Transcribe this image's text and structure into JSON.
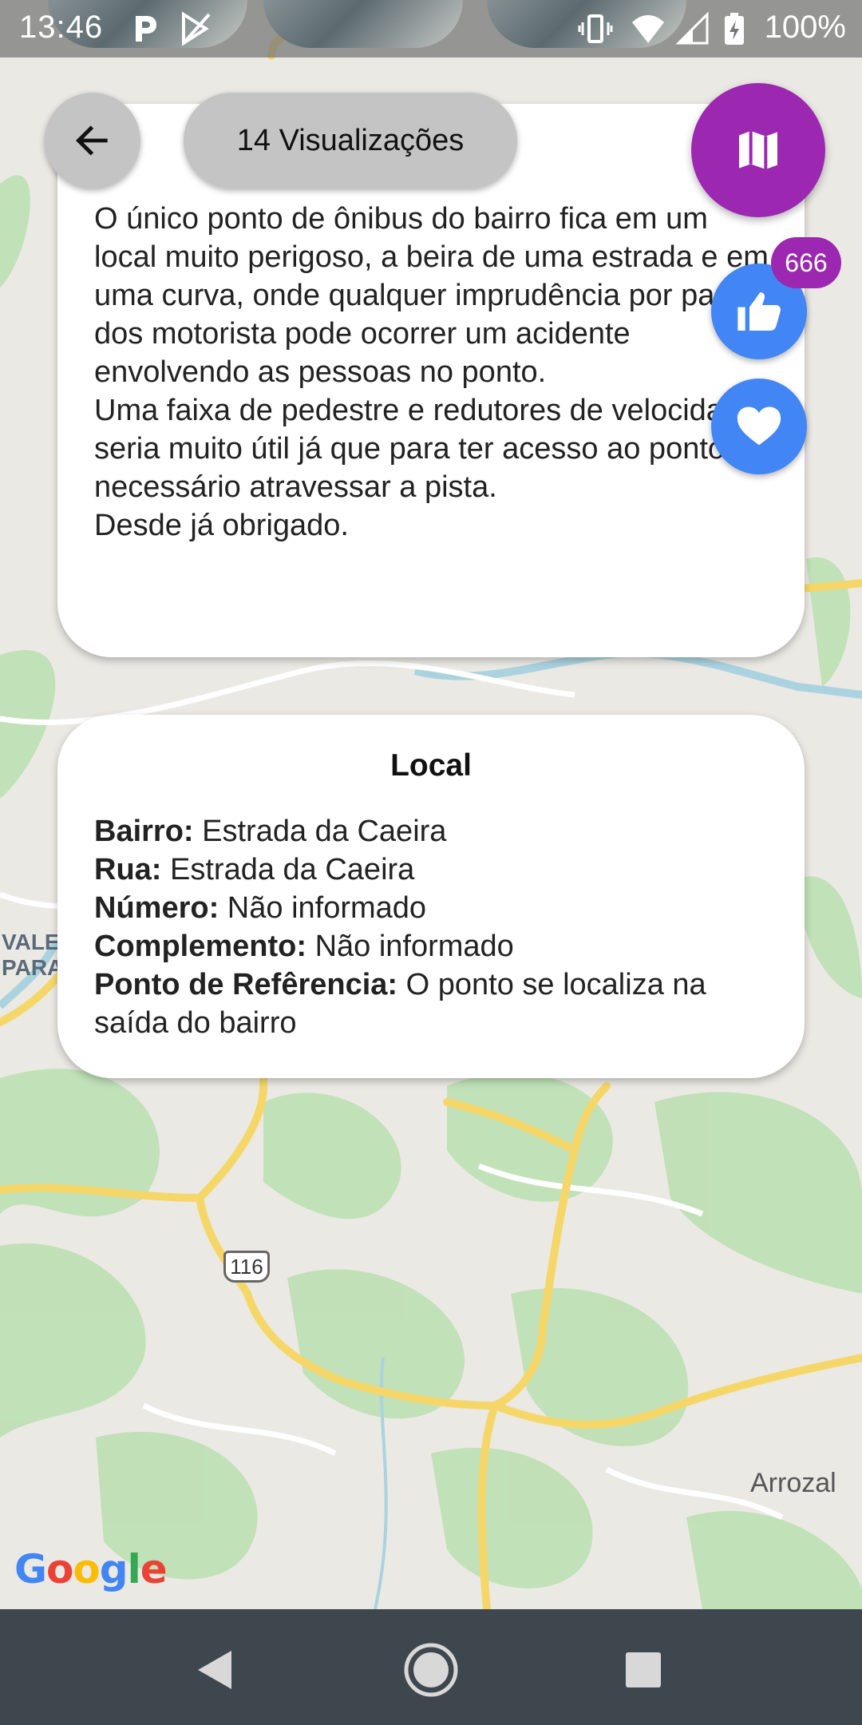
{
  "status_bar": {
    "time": "13:46",
    "battery": "100%"
  },
  "header": {
    "views": "14 Visualizações"
  },
  "actions": {
    "like_count": "666"
  },
  "description": {
    "text": "O único ponto de ônibus do bairro fica em um local muito perigoso, a beira de uma estrada e em uma curva, onde qualquer imprudência por parte dos motorista pode ocorrer um acidente envolvendo as pessoas no ponto.\nUma faixa de pedestre e redutores de velocidade seria muito útil já que para ter acesso ao ponto é necessário atravessar a pista.\nDesde já obrigado."
  },
  "local": {
    "title": "Local",
    "fields": [
      {
        "label": "Bairro:",
        "value": "Estrada da Caeira"
      },
      {
        "label": "Rua:",
        "value": "Estrada da Caeira"
      },
      {
        "label": "Número:",
        "value": "Não informado"
      },
      {
        "label": "Complemento:",
        "value": "Não informado"
      },
      {
        "label": "Ponto de Refêrencia:",
        "value": "O ponto se localiza na saída do bairro"
      }
    ]
  },
  "map": {
    "labels": {
      "arrozal": "Arrozal",
      "vale": "VALE",
      "para": "PARA",
      "route": "116"
    },
    "logo": [
      "G",
      "o",
      "o",
      "g",
      "l",
      "e"
    ]
  },
  "colors": {
    "accent_purple": "#9c27b0",
    "action_blue": "#4285f4",
    "pill_grey": "#c4c4c4",
    "nav_bar": "#3f474e"
  },
  "icons": {
    "back": "arrow-back-icon",
    "map": "map-icon",
    "like": "thumb-up-icon",
    "favorite": "heart-icon"
  }
}
